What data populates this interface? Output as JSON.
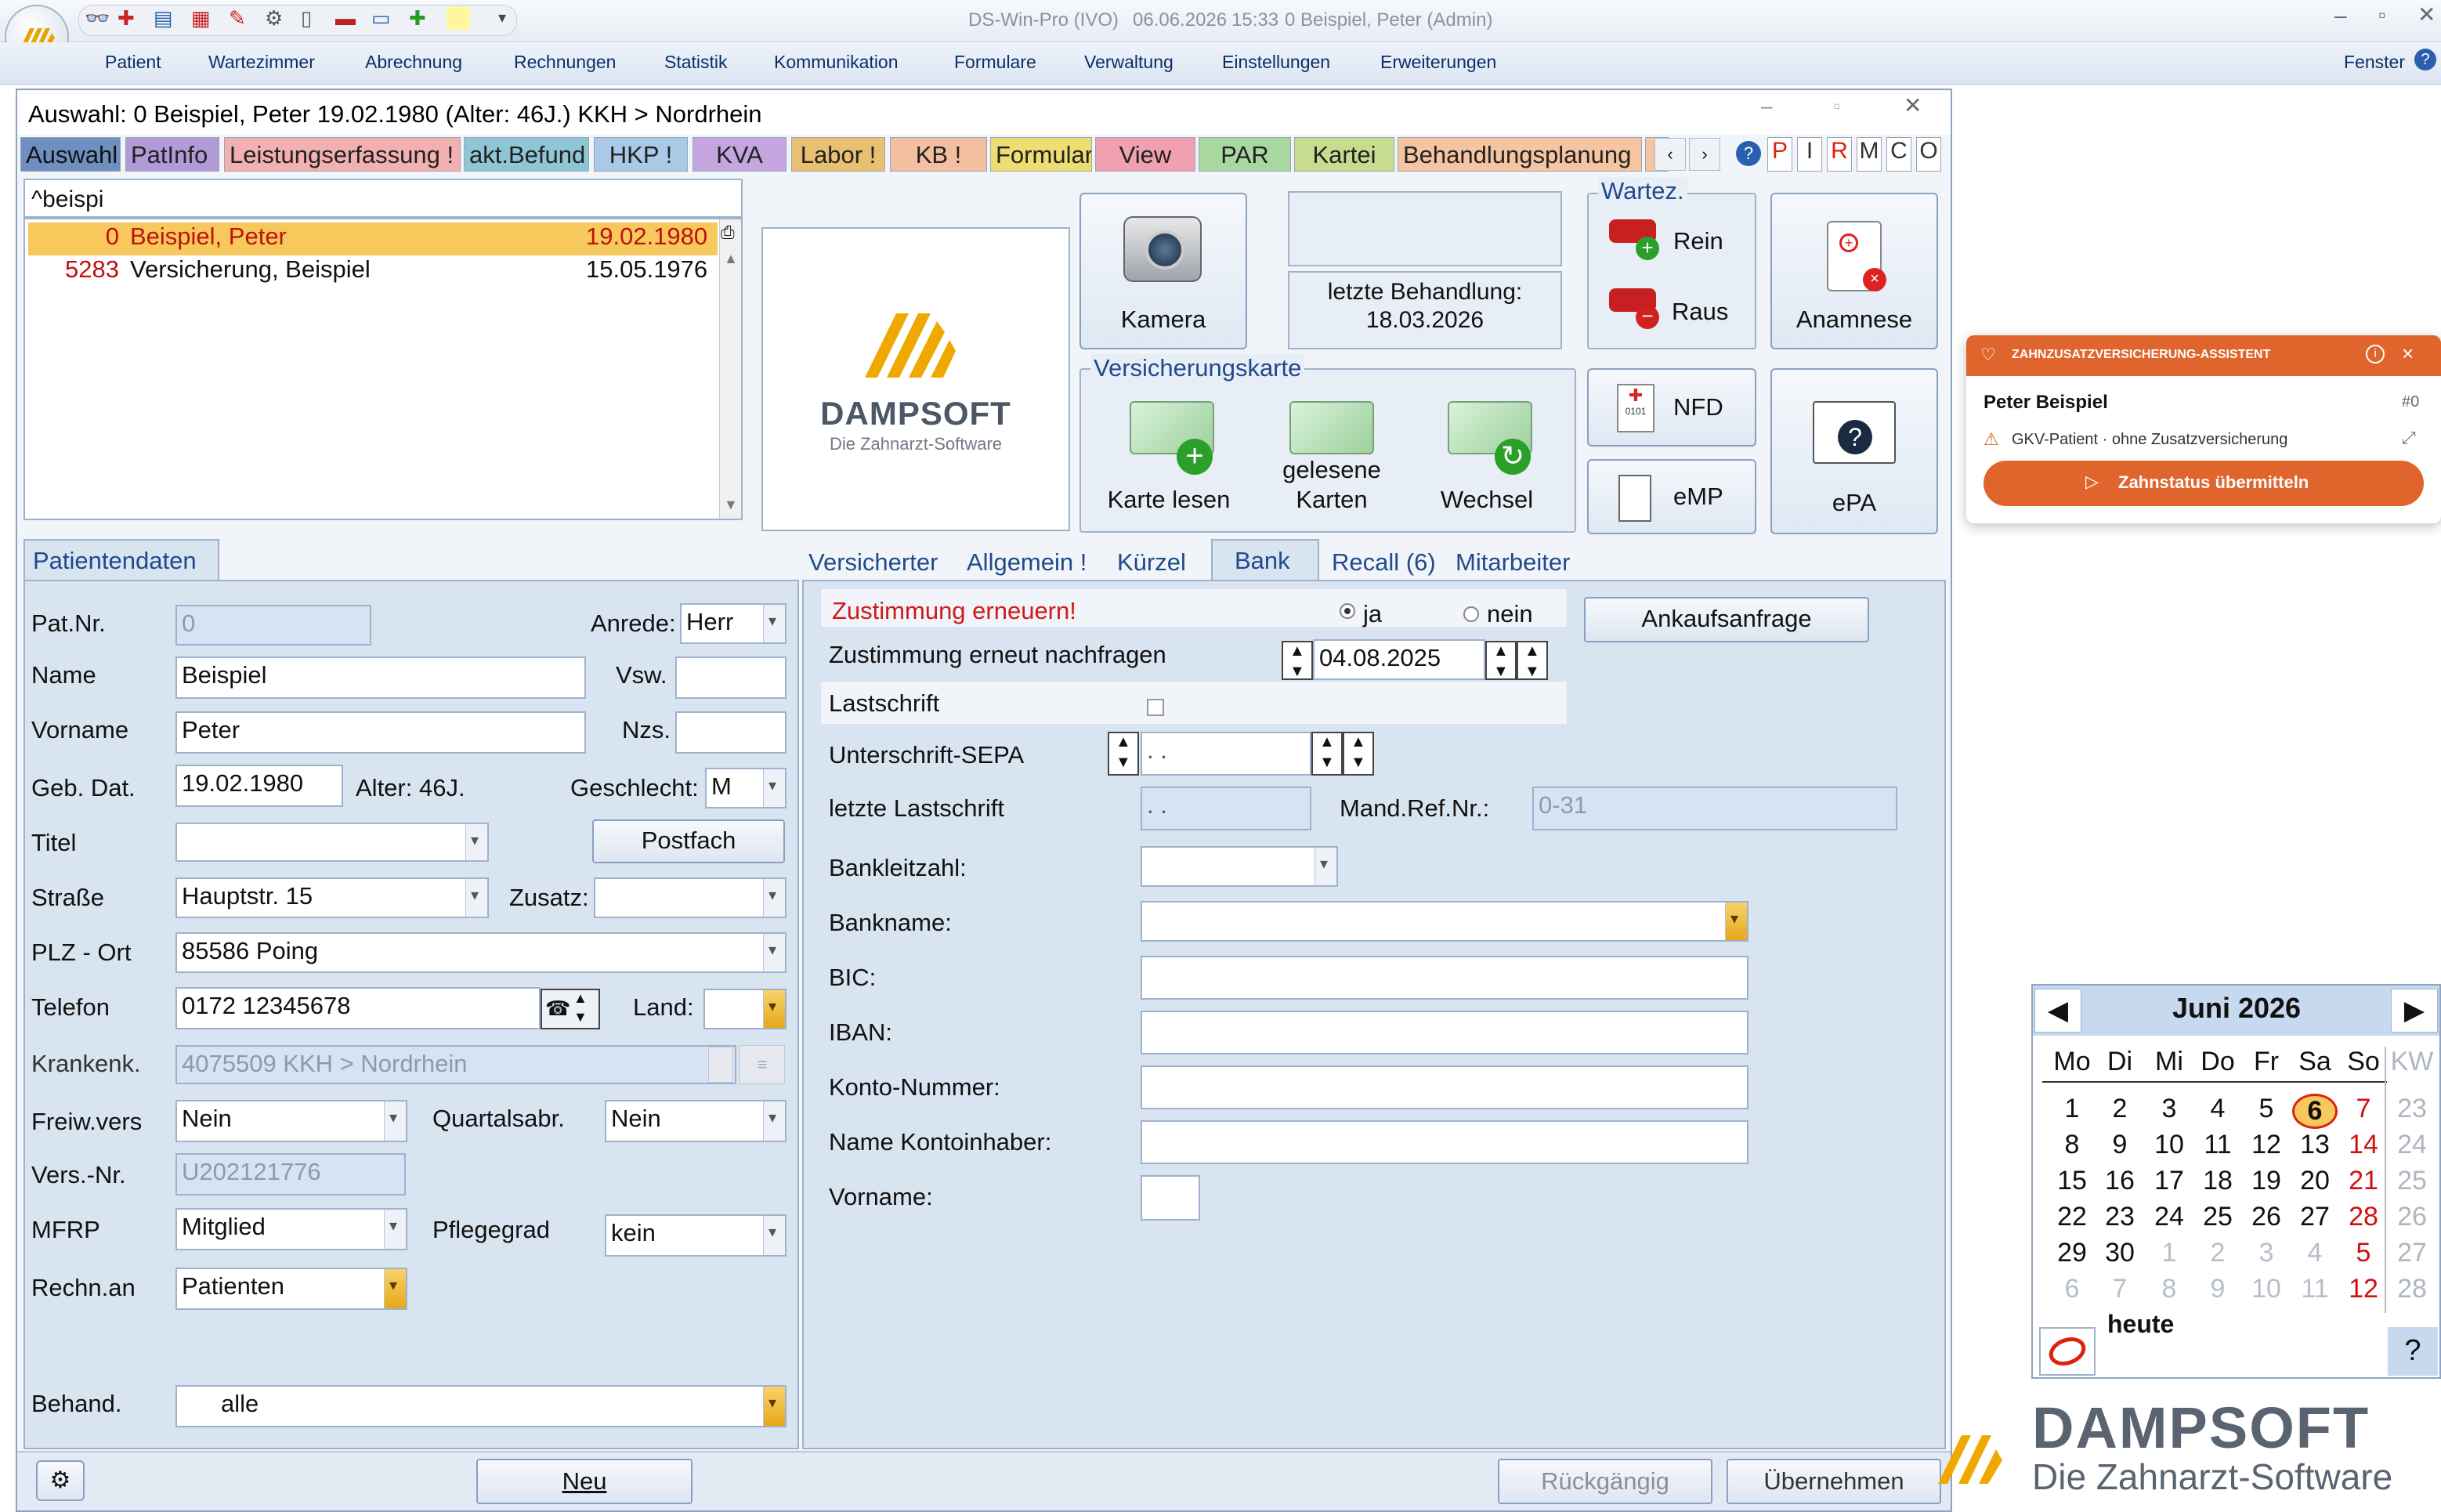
{
  "app": {
    "title": "DS-Win-Pro (IVO)",
    "date": "06.06.2026",
    "time": "15:33",
    "user": "0  Beispiel, Peter (Admin)"
  },
  "menu": [
    "Patient",
    "Wartezimmer",
    "Abrechnung",
    "Rechnungen",
    "Statistik",
    "Kommunikation",
    "Formulare",
    "Verwaltung",
    "Einstellungen",
    "Erweiterungen"
  ],
  "menu_right": "Fenster",
  "window": {
    "title": "Auswahl: 0  Beispiel, Peter  19.02.1980 (Alter: 46J.)  KKH > Nordrhein"
  },
  "tabs": [
    {
      "label": "Auswahl",
      "color": "#6f8fc0"
    },
    {
      "label": "PatInfo",
      "color": "#b29ad8"
    },
    {
      "label": "Leistungserfassung !",
      "color": "#f2b0b0"
    },
    {
      "label": "akt.Befund",
      "color": "#8ec6d6"
    },
    {
      "label": "HKP !",
      "color": "#a9c9e6"
    },
    {
      "label": "KVA",
      "color": "#c5a5e0"
    },
    {
      "label": "Labor !",
      "color": "#e8c070"
    },
    {
      "label": "KB !",
      "color": "#f3bfa0"
    },
    {
      "label": "Formular",
      "color": "#eedd70"
    },
    {
      "label": "View",
      "color": "#f0a0b0"
    },
    {
      "label": "PAR",
      "color": "#a8d8a0"
    },
    {
      "label": "Kartei",
      "color": "#c8dc90"
    },
    {
      "label": "Behandlungsplanung",
      "color": "#f5c4a0"
    }
  ],
  "tab_letters": [
    "P",
    "I",
    "R",
    "M",
    "C",
    "O"
  ],
  "search": {
    "value": "^beispi"
  },
  "patients": [
    {
      "nr": "0",
      "name": "Beispiel, Peter",
      "dob": "19.02.1980"
    },
    {
      "nr": "5283",
      "name": "Versicherung, Beispiel",
      "dob": "15.05.1976"
    }
  ],
  "logo": {
    "brand": "DAMPSOFT",
    "tagline": "Die Zahnarzt-Software"
  },
  "buttons": {
    "kamera": "Kamera",
    "letzte_label": "letzte Behandlung:",
    "letzte_date": "18.03.2026",
    "wartez": "Wartez.",
    "rein": "Rein",
    "raus": "Raus",
    "anamnese": "Anamnese",
    "versicherungskarte": "Versicherungskarte",
    "karte_lesen": "Karte lesen",
    "gelesene_1": "gelesene",
    "gelesene_2": "Karten",
    "wechsel": "Wechsel",
    "nfd": "NFD",
    "emp": "eMP",
    "epa": "ePA"
  },
  "popup": {
    "header": "ZAHNZUSATZVERSICHERUNG-ASSISTENT",
    "name": "Peter Beispiel",
    "num": "#0",
    "status": "GKV-Patient · ohne Zusatzversicherung",
    "action": "Zahnstatus übermitteln",
    "accent": "#e0652d"
  },
  "patientendaten_tab": "Patientendaten",
  "subtabs": [
    "Versicherter",
    "Allgemein !",
    "Kürzel",
    "Bank",
    "Recall (6)",
    "Mitarbeiter"
  ],
  "form": {
    "patnr_label": "Pat.Nr.",
    "patnr": "0",
    "anrede_label": "Anrede:",
    "anrede": "Herr",
    "name_label": "Name",
    "name": "Beispiel",
    "vsw_label": "Vsw.",
    "vorname_label": "Vorname",
    "vorname": "Peter",
    "nzs_label": "Nzs.",
    "gebdat_label": "Geb. Dat.",
    "gebdat": "19.02.1980",
    "alter": "Alter: 46J.",
    "geschlecht_label": "Geschlecht:",
    "geschlecht": "M",
    "titel_label": "Titel",
    "postfach": "Postfach",
    "strasse_label": "Straße",
    "strasse": "Hauptstr. 15",
    "zusatz_label": "Zusatz:",
    "plz_label": "PLZ - Ort",
    "plz": "85586 Poing",
    "telefon_label": "Telefon",
    "telefon": "0172 12345678",
    "land_label": "Land:",
    "krankenk_label": "Krankenk.",
    "krankenk": "4075509 KKH > Nordrhein",
    "freiw_label": "Freiw.vers",
    "freiw": "Nein",
    "quartal_label": "Quartalsabr.",
    "quartal": "Nein",
    "versnr_label": "Vers.-Nr.",
    "versnr": "U202121776",
    "mfrp_label": "MFRP",
    "mfrp": "Mitglied",
    "pflegegrad_label": "Pflegegrad",
    "pflegegrad": "kein",
    "rechn_label": "Rechn.an",
    "rechn": "Patienten",
    "behand_label": "Behand.",
    "behand": "alle"
  },
  "bank": {
    "zustimmung": "Zustimmung erneuern!",
    "ja": "ja",
    "nein": "nein",
    "ankauf": "Ankaufsanfrage",
    "nachfragen_label": "Zustimmung erneut nachfragen",
    "nachfragen": "04.08.2025",
    "lastschrift_label": "Lastschrift",
    "sepa_label": "Unterschrift-SEPA",
    "sepa": " .   .",
    "letzte_label": "letzte Lastschrift",
    "letzte": " .   .",
    "mandref_label": "Mand.Ref.Nr.:",
    "mandref": "0-31",
    "blz_label": "Bankleitzahl:",
    "bankname_label": "Bankname:",
    "bic_label": "BIC:",
    "iban_label": "IBAN:",
    "konto_label": "Konto-Nummer:",
    "inhaber_label": "Name Kontoinhaber:",
    "vorname_label": "Vorname:"
  },
  "bottom": {
    "neu": "Neu",
    "rueck": "Rückgängig",
    "uebernehmen": "Übernehmen"
  },
  "calendar": {
    "month": "Juni 2026",
    "days": [
      "Mo",
      "Di",
      "Mi",
      "Do",
      "Fr",
      "Sa",
      "So",
      "KW"
    ],
    "weeks": [
      {
        "d": [
          "1",
          "2",
          "3",
          "4",
          "5",
          "6",
          "7"
        ],
        "kw": "23"
      },
      {
        "d": [
          "8",
          "9",
          "10",
          "11",
          "12",
          "13",
          "14"
        ],
        "kw": "24"
      },
      {
        "d": [
          "15",
          "16",
          "17",
          "18",
          "19",
          "20",
          "21"
        ],
        "kw": "25"
      },
      {
        "d": [
          "22",
          "23",
          "24",
          "25",
          "26",
          "27",
          "28"
        ],
        "kw": "26"
      },
      {
        "d": [
          "29",
          "30",
          "1",
          "2",
          "3",
          "4",
          "5"
        ],
        "kw": "27"
      },
      {
        "d": [
          "6",
          "7",
          "8",
          "9",
          "10",
          "11",
          "12"
        ],
        "kw": "28"
      }
    ],
    "heute": "heute",
    "help": "?"
  },
  "brand_footer": {
    "name": "DAMPSOFT",
    "tagline": "Die Zahnarzt-Software",
    "color": "#f0a800"
  }
}
